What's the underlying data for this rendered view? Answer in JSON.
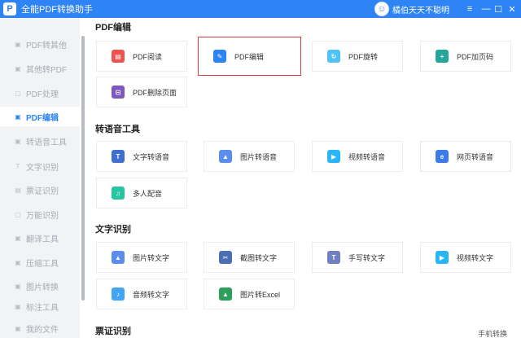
{
  "window": {
    "title": "全能PDF转换助手",
    "logo_letter": "P",
    "user_name": "橘伯天天不聪明",
    "controls": [
      "≡",
      "—",
      "☐",
      "✕"
    ]
  },
  "sidebar": {
    "items": [
      {
        "label": "PDF转其他"
      },
      {
        "label": "其他转PDF"
      },
      {
        "label": "PDF处理"
      },
      {
        "label": "PDF编辑"
      },
      {
        "label": "转语音工具"
      },
      {
        "label": "文字识别"
      },
      {
        "label": "票证识别"
      },
      {
        "label": "万能识别"
      },
      {
        "label": "翻译工具"
      },
      {
        "label": "压缩工具"
      },
      {
        "label": "图片转换"
      },
      {
        "label": "标注工具"
      },
      {
        "label": "我的文件"
      }
    ]
  },
  "sections": [
    {
      "title": "PDF编辑",
      "cards": [
        {
          "label": "PDF阅读",
          "icon": "pdf-read-icon",
          "color": "#ef5350",
          "glyph": "▤"
        },
        {
          "label": "PDF编辑",
          "icon": "pdf-edit-icon",
          "color": "#2f84f5",
          "glyph": "✎"
        },
        {
          "label": "PDF旋转",
          "icon": "pdf-rotate-icon",
          "color": "#4fc3f7",
          "glyph": "↻"
        },
        {
          "label": "PDF加页码",
          "icon": "pdf-page-number-icon",
          "color": "#26a69a",
          "glyph": "+"
        },
        {
          "label": "PDF删除页面",
          "icon": "pdf-delete-page-icon",
          "color": "#7e57c2",
          "glyph": "⊟"
        }
      ]
    },
    {
      "title": "转语音工具",
      "cards": [
        {
          "label": "文字转语音",
          "icon": "text-to-speech-icon",
          "color": "#3f6fd1",
          "glyph": "T"
        },
        {
          "label": "图片转语音",
          "icon": "image-to-speech-icon",
          "color": "#5b8def",
          "glyph": "▲"
        },
        {
          "label": "视频转语音",
          "icon": "video-to-speech-icon",
          "color": "#29b6f6",
          "glyph": "▶"
        },
        {
          "label": "网页转语音",
          "icon": "webpage-to-speech-icon",
          "color": "#3d7bea",
          "glyph": "e"
        },
        {
          "label": "多人配音",
          "icon": "multi-dubbing-icon",
          "color": "#26c6a0",
          "glyph": "♫"
        }
      ]
    },
    {
      "title": "文字识别",
      "cards": [
        {
          "label": "图片转文字",
          "icon": "image-to-text-icon",
          "color": "#5b8def",
          "glyph": "▲"
        },
        {
          "label": "截图转文字",
          "icon": "screenshot-to-text-icon",
          "color": "#4a6fb5",
          "glyph": "✂"
        },
        {
          "label": "手写转文字",
          "icon": "handwriting-to-text-icon",
          "color": "#6f7fbf",
          "glyph": "T"
        },
        {
          "label": "视频转文字",
          "icon": "video-to-text-icon",
          "color": "#29b6f6",
          "glyph": "▶"
        },
        {
          "label": "音频转文字",
          "icon": "audio-to-text-icon",
          "color": "#42a5f5",
          "glyph": "♪"
        },
        {
          "label": "图片转Excel",
          "icon": "image-to-excel-icon",
          "color": "#2e9e5b",
          "glyph": "▲"
        }
      ]
    },
    {
      "title": "票证识别",
      "cards": []
    }
  ],
  "footer": {
    "text": "手机转换"
  }
}
